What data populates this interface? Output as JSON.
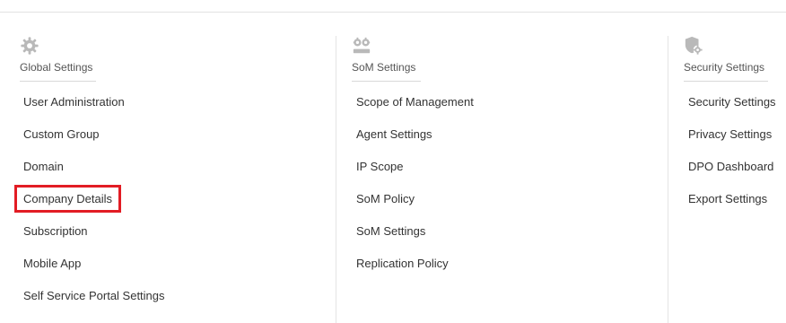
{
  "global": {
    "title": "Global Settings",
    "icon": "gear-icon",
    "items": [
      {
        "label": "User Administration"
      },
      {
        "label": "Custom Group"
      },
      {
        "label": "Domain"
      },
      {
        "label": "Company Details"
      },
      {
        "label": "Subscription"
      },
      {
        "label": "Mobile App"
      },
      {
        "label": "Self Service Portal Settings"
      }
    ]
  },
  "som": {
    "title": "SoM Settings",
    "icon": "som-settings-icon",
    "items": [
      {
        "label": "Scope of Management"
      },
      {
        "label": "Agent Settings"
      },
      {
        "label": "IP Scope"
      },
      {
        "label": "SoM Policy"
      },
      {
        "label": "SoM Settings"
      },
      {
        "label": "Replication Policy"
      }
    ]
  },
  "security": {
    "title": "Security Settings",
    "icon": "shield-gear-icon",
    "items": [
      {
        "label": "Security Settings"
      },
      {
        "label": "Privacy Settings"
      },
      {
        "label": "DPO Dashboard"
      },
      {
        "label": "Export Settings"
      }
    ]
  },
  "colors": {
    "highlight": "#e21c24",
    "icon": "#b9b9b9"
  }
}
